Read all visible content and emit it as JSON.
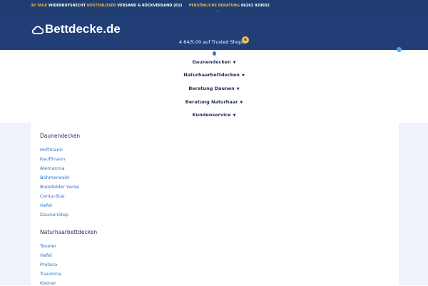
{
  "topbar": {
    "days": "30 TAGE",
    "widerruf": "WIDERRUFSRECHT",
    "kostenlos": "KOSTENLOSER",
    "versand": "VERSAND & RÜCKVERSAND (EU)",
    "beratung": "PERSÖNLICHE BERATUNG",
    "phone": "06262 920032",
    "colors": {
      "highlight": "#f0b63e",
      "background": "#203d71"
    }
  },
  "header": {
    "logo_text": "Bettdecke.de",
    "rating_text": "4.64/5.00 auf Trusted Shops"
  },
  "nav": {
    "items": [
      "Daunendecken",
      "Naturhaarbettdecken",
      "Beratung Daunen",
      "Beratung Naturhaar",
      "Kundenservice"
    ]
  },
  "sections": [
    {
      "title": "Daunendecken",
      "links": [
        "Hoffmann",
        "Kauffmann",
        "Alemannia",
        "Böhmerwald",
        "Bielefelder Verse",
        "Centa-Star",
        "Hefel",
        "DaunenStep"
      ]
    },
    {
      "title": "Naturhaarbettdecken",
      "links": [
        "Texeler",
        "Hefel",
        "Prolana",
        "Traumina",
        "Kleiner"
      ]
    }
  ]
}
